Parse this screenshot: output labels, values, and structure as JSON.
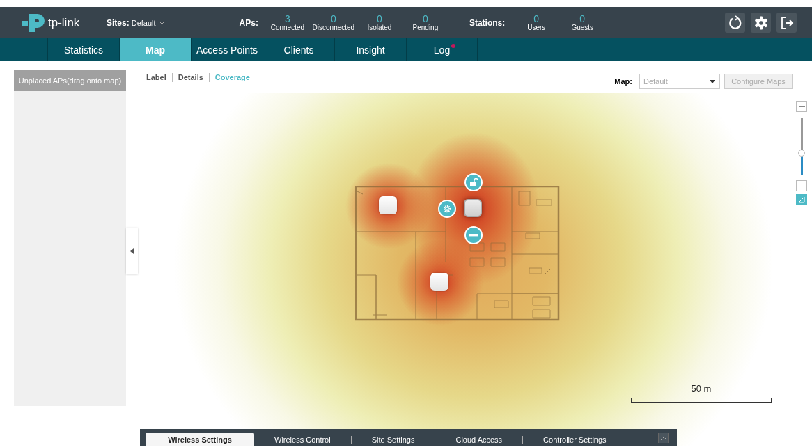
{
  "header": {
    "logo_text": "tp-link",
    "sites_label": "Sites:",
    "site_value": "Default",
    "aps_label": "APs:",
    "ap_stats": [
      {
        "value": "3",
        "label": "Connected"
      },
      {
        "value": "0",
        "label": "Disconnected"
      },
      {
        "value": "0",
        "label": "Isolated"
      },
      {
        "value": "0",
        "label": "Pending"
      }
    ],
    "stations_label": "Stations:",
    "station_stats": [
      {
        "value": "0",
        "label": "Users"
      },
      {
        "value": "0",
        "label": "Guests"
      }
    ]
  },
  "nav_tabs": [
    {
      "label": "Statistics",
      "selected": false,
      "alert": false
    },
    {
      "label": "Map",
      "selected": true,
      "alert": false
    },
    {
      "label": "Access Points",
      "selected": false,
      "alert": false
    },
    {
      "label": "Clients",
      "selected": false,
      "alert": false
    },
    {
      "label": "Insight",
      "selected": false,
      "alert": false
    },
    {
      "label": "Log",
      "selected": false,
      "alert": true
    }
  ],
  "unplaced_panel": {
    "title": "Unplaced APs(drag onto map)"
  },
  "view_options": [
    {
      "label": "Label",
      "selected": false
    },
    {
      "label": "Details",
      "selected": false
    },
    {
      "label": "Coverage",
      "selected": true
    }
  ],
  "map_select": {
    "label": "Map:",
    "value": "Default"
  },
  "configure_button": {
    "label": "Configure Maps",
    "disabled": true
  },
  "access_points": [
    {
      "selected": false
    },
    {
      "selected": true
    },
    {
      "selected": false
    }
  ],
  "zoom": {
    "level": 0.38
  },
  "scale": {
    "label": "50 m"
  },
  "bottom_tabs": [
    {
      "label": "Wireless Settings",
      "selected": true
    },
    {
      "label": "Wireless Control",
      "selected": false
    },
    {
      "label": "Site Settings",
      "selected": false
    },
    {
      "label": "Cloud Access",
      "selected": false
    },
    {
      "label": "Controller Settings",
      "selected": false
    }
  ]
}
